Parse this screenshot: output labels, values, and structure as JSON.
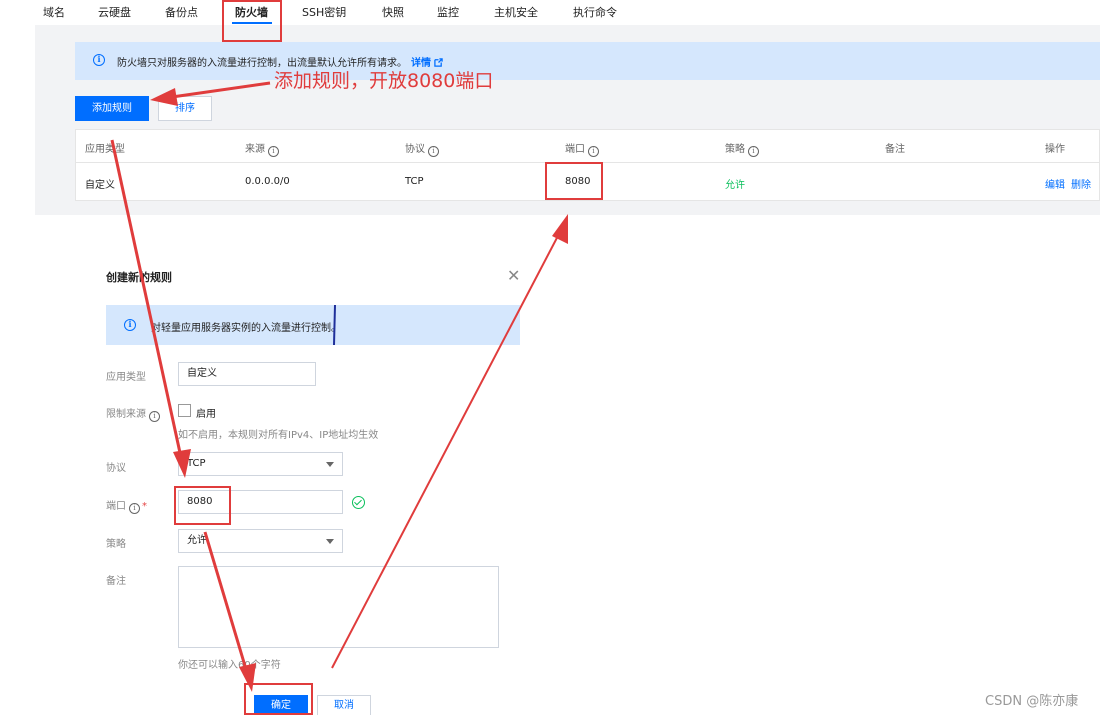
{
  "tabs": [
    {
      "label": "域名"
    },
    {
      "label": "云硬盘"
    },
    {
      "label": "备份点"
    },
    {
      "label": "防火墙"
    },
    {
      "label": "SSH密钥"
    },
    {
      "label": "快照"
    },
    {
      "label": "监控"
    },
    {
      "label": "主机安全"
    },
    {
      "label": "执行命令"
    }
  ],
  "active_tab": "防火墙",
  "notice": {
    "text": "防火墙只对服务器的入流量进行控制，出流量默认允许所有请求。",
    "link": "详情"
  },
  "toolbar": {
    "add_label": "添加规则",
    "sort_label": "排序"
  },
  "table": {
    "headers": {
      "type": "应用类型",
      "source": "来源",
      "protocol": "协议",
      "port": "端口",
      "policy": "策略",
      "remark": "备注",
      "actions": "操作"
    },
    "rows": [
      {
        "type": "自定义",
        "source": "0.0.0.0/0",
        "protocol": "TCP",
        "port": "8080",
        "policy": "允许",
        "edit": "编辑",
        "delete": "删除"
      }
    ]
  },
  "dialog": {
    "title": "创建新的规则",
    "notice": "对轻量应用服务器实例的入流量进行控制。",
    "fields": {
      "app_type_label": "应用类型",
      "app_type_value": "自定义",
      "source_limit_label": "限制来源",
      "enable_label": "启用",
      "source_hint": "如不启用，本规则对所有IPv4、IP地址均生效",
      "protocol_label": "协议",
      "protocol_value": "TCP",
      "port_label": "端口",
      "port_value": "8080",
      "policy_label": "策略",
      "policy_value": "允许",
      "remark_label": "备注",
      "remark_hint": "你还可以输入60个字符"
    },
    "confirm_label": "确定",
    "cancel_label": "取消"
  },
  "annotation": "添加规则，开放8080端口",
  "watermark": "CSDN @陈亦康",
  "colors": {
    "primary": "#006eff",
    "success": "#0abf5b",
    "annotation_red": "#e03c3c",
    "notice_bg": "#d5e7fd"
  }
}
